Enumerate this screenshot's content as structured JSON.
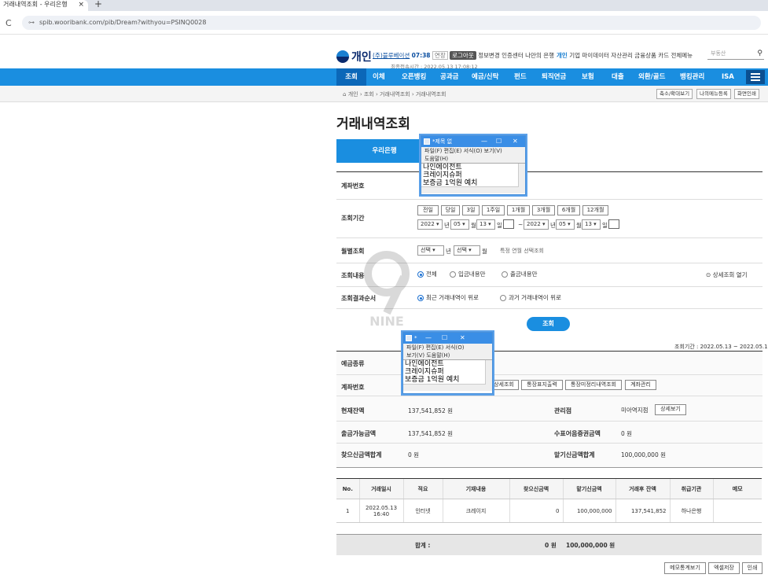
{
  "browser": {
    "tab_title": "거래내역조회 - 우리은행",
    "tab_close": "×",
    "new_tab": "+",
    "url": "spib.wooribank.com/pib/Dream?withyou=PSINQ0028"
  },
  "header": {
    "logo_text": "개인",
    "company": "(주)블루베이션",
    "session_time": "07:38",
    "extend": "연장",
    "logout": "로그아웃",
    "info_change": "정보변경",
    "cert_center": "인증센터",
    "my_bank": "나만의 은행",
    "last_login": "최종접속시간 : 2022.05.13 17:08:12",
    "top_menu": [
      "개인",
      "기업",
      "마이데이터",
      "자산관리",
      "금융상품",
      "카드",
      "전체메뉴"
    ],
    "search_placeholder": "부동산"
  },
  "nav": {
    "items": [
      "조회",
      "이체",
      "오픈뱅킹",
      "공과금",
      "예금/신탁",
      "펀드",
      "퇴직연금",
      "보험",
      "대출",
      "외환/골드",
      "뱅킹관리",
      "ISA"
    ]
  },
  "breadcrumb": {
    "home": "개인",
    "path": "› 조회 › 거래내역조회 › 거래내역조회",
    "zoom": "축소/확대보기",
    "my_menu": "나의메뉴등록",
    "print": "화면인쇄"
  },
  "page": {
    "title": "거래내역조회",
    "bank_tab": "우리은행"
  },
  "form": {
    "account_label": "계좌번호",
    "period_label": "조회기간",
    "period_buttons": [
      "전일",
      "당일",
      "3일",
      "1주일",
      "1개월",
      "3개월",
      "6개월",
      "12개월"
    ],
    "from": {
      "year": "2022",
      "month": "05",
      "day": "13"
    },
    "to": {
      "year": "2022",
      "month": "05",
      "day": "13"
    },
    "unit_year": "년",
    "unit_month": "월",
    "unit_day": "일",
    "tilde": "~",
    "monthly_label": "월별조회",
    "monthly_select": "선택",
    "monthly_note": "특정 연월 선택조회",
    "content_label": "조회내용",
    "content_options": [
      "전체",
      "입금내용만",
      "출금내용만"
    ],
    "detail_toggle": "상세조회 열기",
    "order_label": "조회결과순서",
    "order_options": [
      "최근 거래내역이 위로",
      "과거 거래내역이 위로"
    ],
    "search_button": "조회"
  },
  "summary": {
    "period_text": "조회기간 : 2022.05.13 ~ 2022.05.13",
    "deposit_type_label": "예금종류",
    "account_label": "계좌번호",
    "account_buttons": [
      "상세조회",
      "통장표지출력",
      "통장미정리내역조회",
      "계좌관리"
    ],
    "balance_label": "현재잔액",
    "balance_value": "137,541,852 원",
    "branch_label": "관리점",
    "branch_value": "미아역지점",
    "branch_button": "상세보기",
    "withdrawable_label": "출금가능금액",
    "withdrawable_value": "137,541,852 원",
    "check_label": "수표어음증권금액",
    "check_value": "0 원",
    "withdraw_total_label": "찾으신금액합계",
    "withdraw_total_value": "0 원",
    "deposit_total_label": "맡기신금액합계",
    "deposit_total_value": "100,000,000 원"
  },
  "table": {
    "headers": [
      "No.",
      "거래일시",
      "적요",
      "기재내용",
      "찾으신금액",
      "맡기신금액",
      "거래후 잔액",
      "취급기관",
      "메모"
    ],
    "rows": [
      [
        "1",
        "2022.05.13 16:40",
        "인터넷",
        "크레이지",
        "0",
        "100,000,000",
        "137,541,852",
        "하나은행",
        ""
      ]
    ],
    "sum_label": "합계 :",
    "sum_withdraw": "0 원",
    "sum_deposit": "100,000,000 원"
  },
  "bottom_buttons": [
    "메모통계보기",
    "엑셀저장",
    "인쇄"
  ],
  "notepad1": {
    "title": "*제목 없",
    "menu_line1": "파일(F)   편집(E)   서식(O)   보기(V)",
    "menu_line2": "도움말(H)",
    "lines": [
      "나인에이전트",
      "크레이지슈퍼",
      "보증금 1억원 예치"
    ]
  },
  "notepad2": {
    "title": "*",
    "menu_line1": "파일(F)   편집(E)   서식(O)",
    "menu_line2": "보기(V)   도움말(H)",
    "lines": [
      "나인에이전트",
      "크레이지슈퍼",
      "보증금 1억원 예치"
    ]
  },
  "watermark": {
    "text": "NINE"
  },
  "colors": {
    "accent": "#1a8ee0",
    "nav_active": "#0b67b8",
    "brand_dark": "#0a2a6e"
  }
}
